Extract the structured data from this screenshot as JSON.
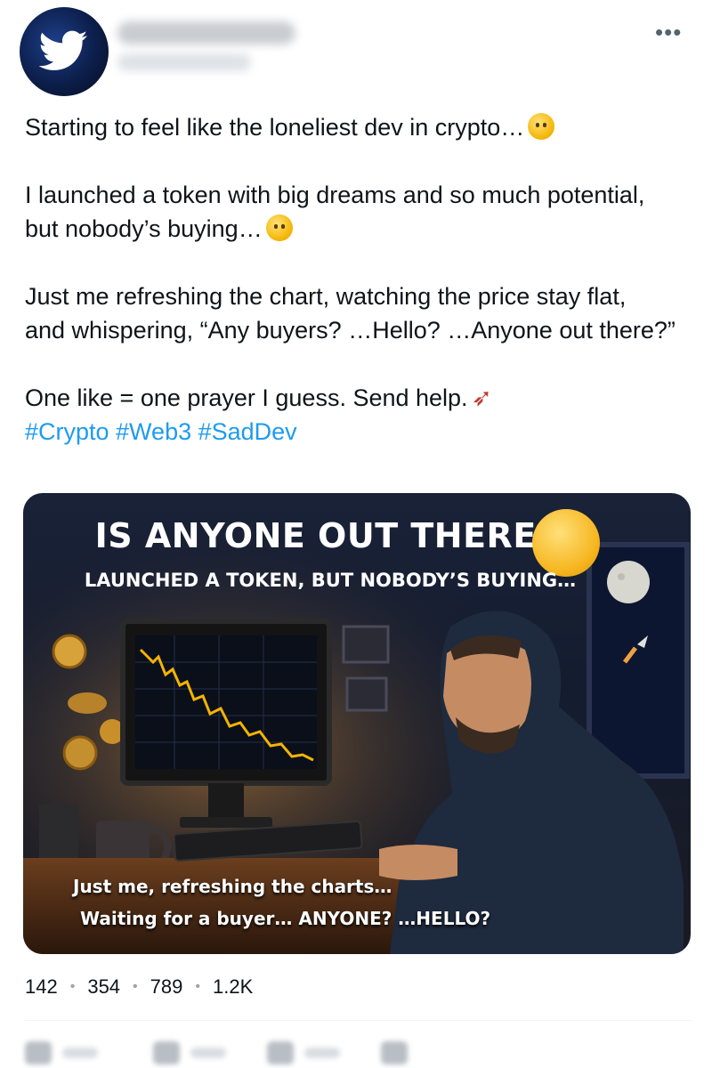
{
  "header": {
    "avatar_icon": "bird-icon",
    "more_label": "•••"
  },
  "tweet": {
    "line1": "Starting to feel like the loneliest dev in crypto…",
    "para2_line1": "I launched a token with big dreams and so much potential,",
    "para2_line2": "but nobody’s buying…",
    "para3_line1": "Just me refreshing the chart, watching the price stay flat,",
    "para3_line2": "and whispering, “Any buyers? …Hello? …Anyone out there?”",
    "para4_line1": "One like = one prayer I guess. Send help.",
    "hashtags": "#Crypto #Web3 #SadDev"
  },
  "media": {
    "title": "IS ANYONE OUT THERE?",
    "subtitle": "LAUNCHED A TOKEN, BUT NOBODY’S BUYING…",
    "caption_line1": "Just me, refreshing the charts…",
    "caption_line2": "Waiting for a buyer… ANYONE? …HELLO?"
  },
  "stats": {
    "replies": "142",
    "reposts": "354",
    "likes": "789",
    "views": "1.2K"
  },
  "colors": {
    "link": "#1d9bf0",
    "text": "#0f1419",
    "muted": "#536471"
  }
}
